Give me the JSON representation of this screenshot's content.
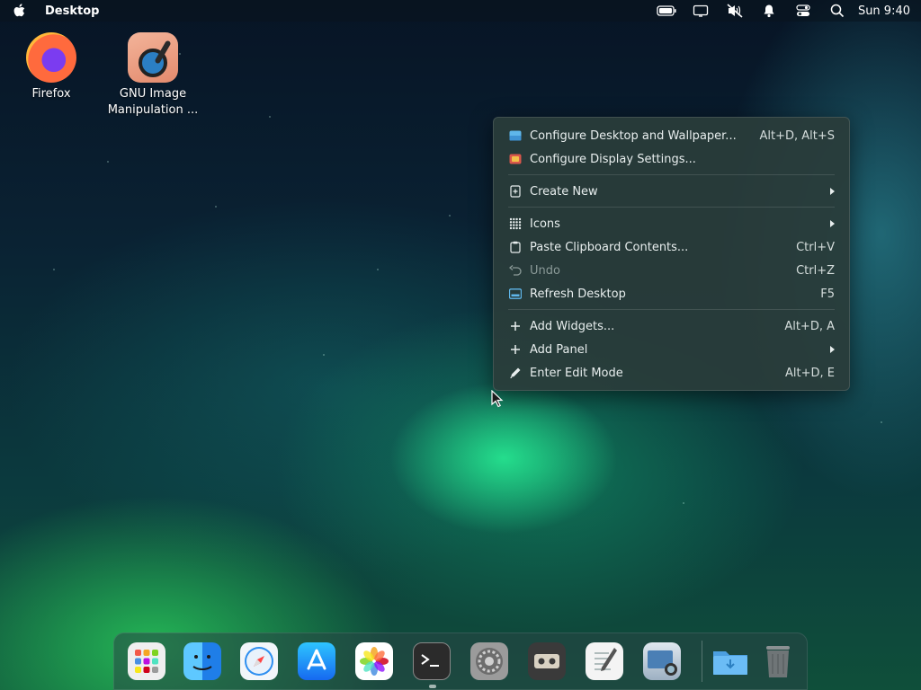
{
  "topbar": {
    "app_title": "Desktop",
    "clock": "Sun 9:40",
    "tray_icons": [
      "battery-icon",
      "display-icon",
      "muted-speaker-icon",
      "bell-icon",
      "control-center-icon",
      "search-icon"
    ]
  },
  "desktop_icons": [
    {
      "label": "Firefox",
      "icon": "firefox-icon"
    },
    {
      "label": "GNU Image Manipulation ...",
      "icon": "gimp-icon"
    }
  ],
  "context_menu": {
    "items": [
      {
        "label": "Configure Desktop and Wallpaper...",
        "shortcut": "Alt+D, Alt+S",
        "icon": "wallpaper-icon"
      },
      {
        "label": "Configure Display Settings...",
        "shortcut": "",
        "icon": "display-settings-icon"
      },
      {
        "label": "Create New",
        "shortcut": "",
        "icon": "new-file-icon",
        "submenu": true
      },
      {
        "label": "Icons",
        "shortcut": "",
        "icon": "grid-icon",
        "submenu": true
      },
      {
        "label": "Paste Clipboard Contents...",
        "shortcut": "Ctrl+V",
        "icon": "clipboard-icon"
      },
      {
        "label": "Undo",
        "shortcut": "Ctrl+Z",
        "icon": "undo-icon",
        "disabled": true
      },
      {
        "label": "Refresh Desktop",
        "shortcut": "F5",
        "icon": "refresh-desktop-icon"
      },
      {
        "label": "Add Widgets...",
        "shortcut": "Alt+D, A",
        "icon": "plus-icon"
      },
      {
        "label": "Add Panel",
        "shortcut": "",
        "icon": "plus-icon",
        "submenu": true
      },
      {
        "label": "Enter Edit Mode",
        "shortcut": "Alt+D, E",
        "icon": "pencil-icon"
      }
    ]
  },
  "dock": {
    "items": [
      {
        "name": "launchpad-icon",
        "color": "#e8e8e8"
      },
      {
        "name": "finder-icon",
        "color": "#2d8ff0"
      },
      {
        "name": "safari-icon",
        "color": "#e9f2fb"
      },
      {
        "name": "app-store-icon",
        "color": "#1c8cf2"
      },
      {
        "name": "photos-icon",
        "color": "#ffffff"
      },
      {
        "name": "terminal-icon",
        "color": "#2b2b2b"
      },
      {
        "name": "system-settings-icon",
        "color": "#8c8c8c"
      },
      {
        "name": "tape-recorder-icon",
        "color": "#3a3a3a"
      },
      {
        "name": "text-editor-icon",
        "color": "#f2f2f2"
      },
      {
        "name": "screenshot-icon",
        "color": "#cfd8e0"
      },
      {
        "name": "downloads-folder-icon",
        "color": "#5aaef0"
      },
      {
        "name": "trash-icon",
        "color": "#6f7577"
      }
    ]
  }
}
